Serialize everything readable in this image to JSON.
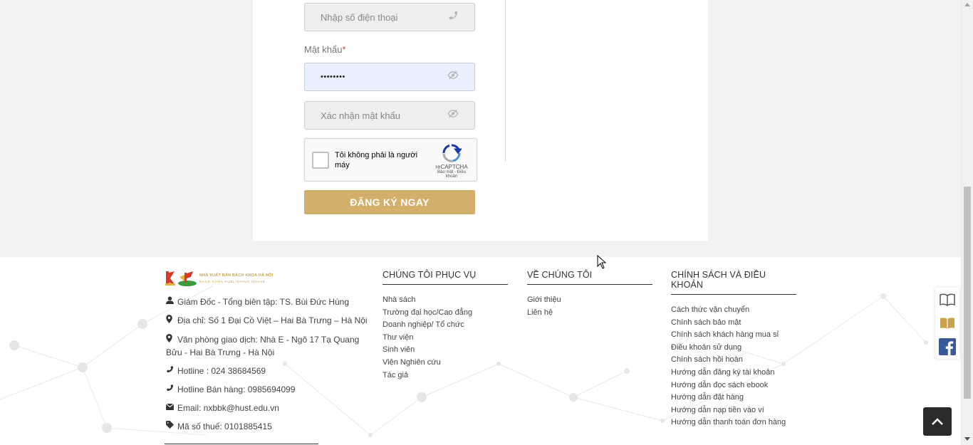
{
  "form": {
    "phone_placeholder": "Nhập số điện thoại",
    "password_label": "Mật khẩu",
    "password_required_mark": "*",
    "password_value": "••••••••",
    "confirm_placeholder": "Xác nhận mật khẩu",
    "captcha": {
      "label": "Tôi không phải là người máy",
      "brand": "reCAPTCHA",
      "terms": "Bảo mật - Điều khoản"
    },
    "submit_label": "ĐĂNG KÝ NGAY"
  },
  "footer": {
    "logo": {
      "line1": "NHÀ XUẤT BẢN BÁCH KHOA HÀ NỘI",
      "line2": "BACH KHOA PUBLISHING HOUSE"
    },
    "info": {
      "director": "Giám Đốc - Tổng biên tập: TS. Bùi Đức Hùng",
      "address": "Địa chỉ: Số 1 Đại Cồ Việt – Hai Bà Trưng – Hà Nội",
      "office": "Văn phòng giao dịch: Nhà E - Ngõ 17 Tạ Quang Bửu - Hai Bà Trưng - Hà Nội",
      "hotline": "Hotline : 024 38684569",
      "sales_hotline": "Hotline Bán hàng: 0985694099",
      "email": "Email: nxbbk@hust.edu.vn",
      "tax": "Mã số thuế: 0101885415"
    },
    "columns": [
      {
        "title": "CHÚNG TÔI PHỤC VỤ",
        "links": [
          "Nhà sách",
          "Trường đại học/Cao đẳng",
          "Doanh nghiệp/ Tổ chức",
          "Thư viện",
          "Sinh viên",
          "Viện Nghiên cứu",
          "Tác giả"
        ]
      },
      {
        "title": "VỀ CHÚNG TÔI",
        "links": [
          "Giới thiệu",
          "Liên hệ"
        ]
      },
      {
        "title": "CHÍNH SÁCH VÀ ĐIỀU KHOẢN",
        "links": [
          "Cách thức vận chuyển",
          "Chính sách bảo mật",
          "Chính sách khách hàng mua sỉ",
          "Điều khoản sử dụng",
          "Chính sách hồi hoàn",
          "Hướng dẫn đăng ký tài khoản",
          "Hướng dẫn đọc sách ebook",
          "Hướng dẫn đặt hàng",
          "Hướng dẫn nạp tiền vào ví",
          "Hướng dẫn thanh toán đơn hàng"
        ]
      }
    ]
  },
  "colors": {
    "accent": "#d2b06b",
    "facebook": "#3b5998",
    "autofill": "#e8f0fe"
  }
}
